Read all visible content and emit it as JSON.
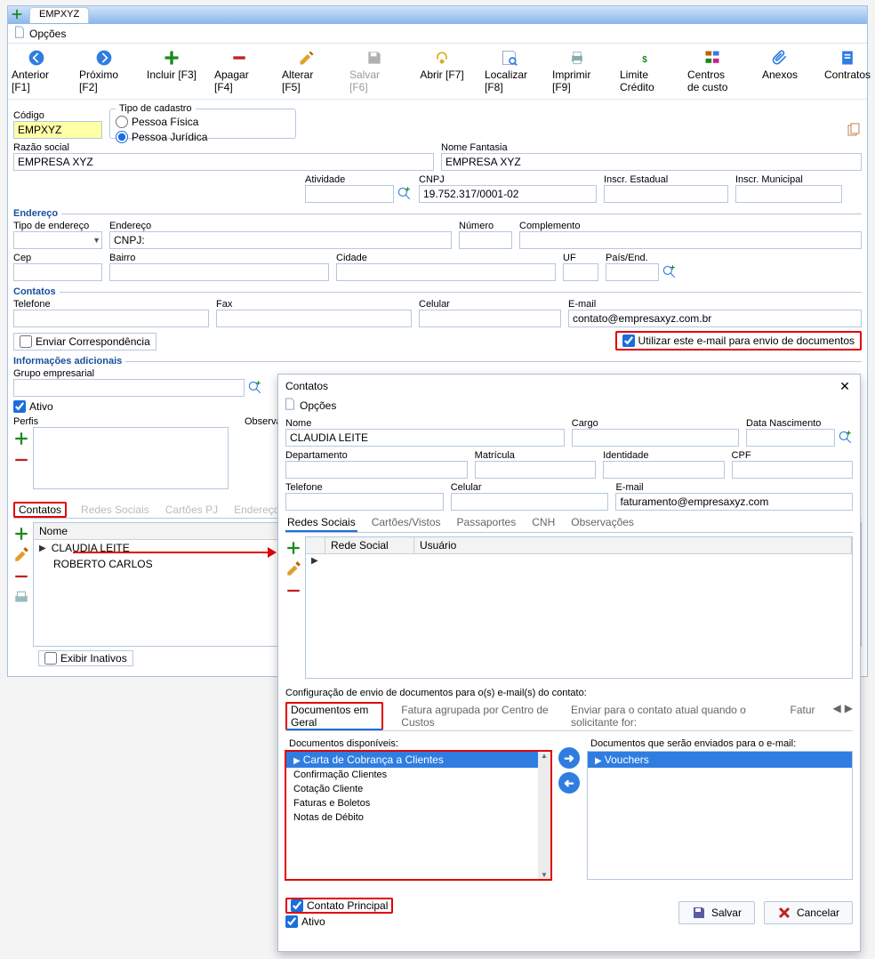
{
  "window": {
    "tab_title": "EMPXYZ",
    "options_label": "Opções"
  },
  "toolbar": {
    "anterior": "Anterior [F1]",
    "proximo": "Próximo [F2]",
    "incluir": "Incluir [F3]",
    "apagar": "Apagar [F4]",
    "alterar": "Alterar [F5]",
    "salvar": "Salvar [F6]",
    "abrir": "Abrir [F7]",
    "localizar": "Localizar [F8]",
    "imprimir": "Imprimir [F9]",
    "limite": "Limite Crédito",
    "centros": "Centros de custo",
    "anexos": "Anexos",
    "contratos": "Contratos"
  },
  "fields": {
    "codigo_label": "Código",
    "codigo_value": "EMPXYZ",
    "tipo_cadastro_legend": "Tipo de cadastro",
    "pf": "Pessoa Física",
    "pj": "Pessoa Jurídica",
    "razao_label": "Razão social",
    "razao_value": "EMPRESA XYZ",
    "fantasia_label": "Nome Fantasia",
    "fantasia_value": "EMPRESA XYZ",
    "atividade_label": "Atividade",
    "cnpj_label": "CNPJ",
    "cnpj_value": "19.752.317/0001-02",
    "inscr_est_label": "Inscr. Estadual",
    "inscr_mun_label": "Inscr. Municipal"
  },
  "endereco": {
    "title": "Endereço",
    "tipo_label": "Tipo de endereço",
    "endereco_label": "Endereço",
    "endereco_value": "CNPJ:",
    "numero_label": "Número",
    "complemento_label": "Complemento",
    "cep_label": "Cep",
    "bairro_label": "Bairro",
    "cidade_label": "Cidade",
    "uf_label": "UF",
    "pais_label": "País/End."
  },
  "contatos_sec": {
    "title": "Contatos",
    "tel_label": "Telefone",
    "fax_label": "Fax",
    "cel_label": "Celular",
    "email_label": "E-mail",
    "email_value": "contato@empresaxyz.com.br",
    "enviar_corr": "Enviar Correspondência",
    "use_email": "Utilizar este e-mail para envio de documentos"
  },
  "info_adicionais": {
    "title": "Informações adicionais",
    "grupo_label": "Grupo empresarial",
    "ativo": "Ativo",
    "perfis_label": "Perfis",
    "obs_label": "Observações"
  },
  "inner_tabs": {
    "contatos": "Contatos",
    "redes": "Redes Sociais",
    "cartoes": "Cartões PJ",
    "end_cobr": "Endereço Cobr"
  },
  "contacts_grid": {
    "col_nome": "Nome",
    "rows": [
      "CLAUDIA LEITE",
      "ROBERTO CARLOS"
    ],
    "exibir_inativos": "Exibir Inativos"
  },
  "modal": {
    "title": "Contatos",
    "options": "Opções",
    "nome_label": "Nome",
    "nome_value": "CLAUDIA LEITE",
    "cargo_label": "Cargo",
    "data_nasc_label": "Data Nascimento",
    "depto_label": "Departamento",
    "matricula_label": "Matrícula",
    "identidade_label": "Identidade",
    "cpf_label": "CPF",
    "tel_label": "Telefone",
    "cel_label": "Celular",
    "email_label": "E-mail",
    "email_value": "faturamento@empresaxyz.com",
    "tabs": {
      "redes": "Redes Sociais",
      "cartoes": "Cartões/Vistos",
      "passaportes": "Passaportes",
      "cnh": "CNH",
      "obs": "Observações"
    },
    "redes_grid": {
      "col1": "Rede Social",
      "col2": "Usuário"
    },
    "config_label": "Configuração de envio de documentos para o(s) e-mail(s) do contato:",
    "doc_tabs": {
      "geral": "Documentos em Geral",
      "fatura": "Fatura agrupada por Centro de Custos",
      "enviar": "Enviar para o contato atual quando o solicitante for:",
      "fat": "Fatur"
    },
    "disp_label": "Documentos disponíveis:",
    "disp_items": [
      "Carta de Cobrança a Clientes",
      "Confirmação Clientes",
      "Cotação Cliente",
      "Faturas e Boletos",
      "Notas de Débito"
    ],
    "enviados_label": "Documentos que serão enviados para o e-mail:",
    "enviados_items": [
      "Vouchers"
    ],
    "contato_principal": "Contato Principal",
    "ativo": "Ativo",
    "salvar_btn": "Salvar",
    "cancelar_btn": "Cancelar"
  }
}
